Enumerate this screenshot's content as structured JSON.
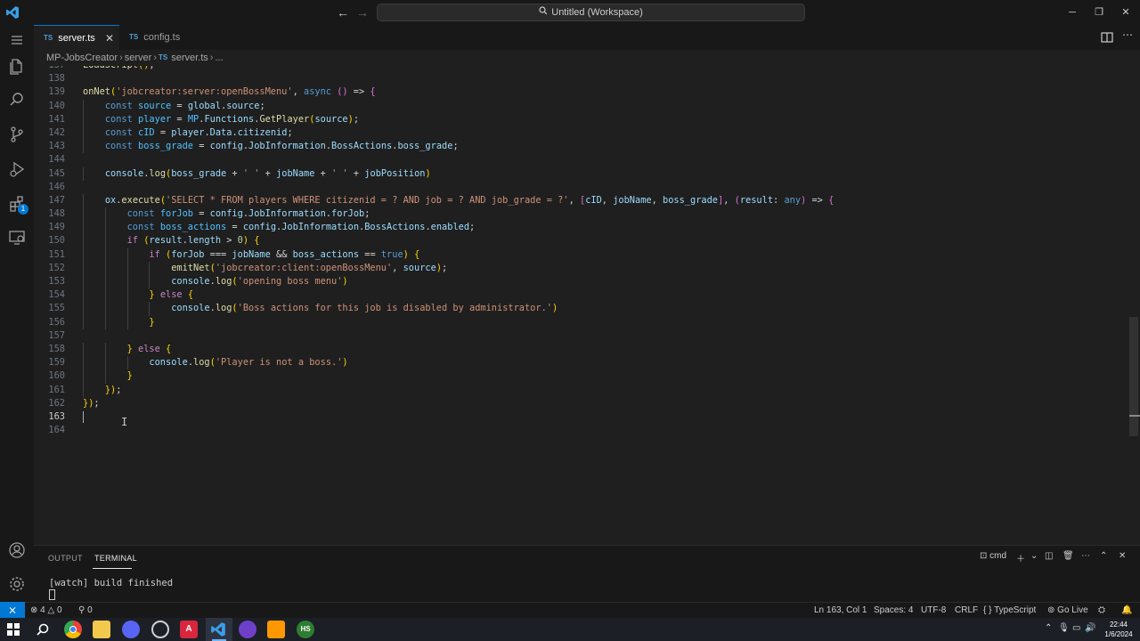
{
  "window": {
    "title": "Untitled (Workspace)"
  },
  "tabs": [
    {
      "icon": "TS",
      "label": "server.ts",
      "close": "✕"
    },
    {
      "icon": "TS",
      "label": "config.ts"
    }
  ],
  "breadcrumb": {
    "items": [
      "MP-JobsCreator",
      "server",
      "server.ts",
      "..."
    ],
    "file_icon": "TS"
  },
  "editor": {
    "cursor_line": 163,
    "lines": [
      {
        "n": "137",
        "code": "LoadScript();"
      },
      {
        "n": "138",
        "code": ""
      },
      {
        "n": "139",
        "code": "onNet('jobcreator:server:openBossMenu', async () => {"
      },
      {
        "n": "140",
        "code": "    const source = global.source;"
      },
      {
        "n": "141",
        "code": "    const player = MP.Functions.GetPlayer(source);"
      },
      {
        "n": "142",
        "code": "    const cID = player.Data.citizenid;"
      },
      {
        "n": "143",
        "code": "    const boss_grade = config.JobInformation.BossActions.boss_grade;"
      },
      {
        "n": "144",
        "code": ""
      },
      {
        "n": "145",
        "code": "    console.log(boss_grade + ' ' + jobName + ' ' + jobPosition)"
      },
      {
        "n": "146",
        "code": ""
      },
      {
        "n": "147",
        "code": "    ox.execute('SELECT * FROM players WHERE citizenid = ? AND job = ? AND job_grade = ?', [cID, jobName, boss_grade], (result: any) => {"
      },
      {
        "n": "148",
        "code": "        const forJob = config.JobInformation.forJob;"
      },
      {
        "n": "149",
        "code": "        const boss_actions = config.JobInformation.BossActions.enabled;"
      },
      {
        "n": "150",
        "code": "        if (result.length > 0) {"
      },
      {
        "n": "151",
        "code": "            if (forJob === jobName && boss_actions == true) {"
      },
      {
        "n": "152",
        "code": "                emitNet('jobcreator:client:openBossMenu', source);"
      },
      {
        "n": "153",
        "code": "                console.log('opening boss menu')"
      },
      {
        "n": "154",
        "code": "            } else {"
      },
      {
        "n": "155",
        "code": "                console.log('Boss actions for this job is disabled by administrator.')"
      },
      {
        "n": "156",
        "code": "            }"
      },
      {
        "n": "157",
        "code": ""
      },
      {
        "n": "158",
        "code": "        } else {"
      },
      {
        "n": "159",
        "code": "            console.log('Player is not a boss.')"
      },
      {
        "n": "160",
        "code": "        }"
      },
      {
        "n": "161",
        "code": "    });"
      },
      {
        "n": "162",
        "code": "});"
      },
      {
        "n": "163",
        "code": ""
      },
      {
        "n": "164",
        "code": ""
      }
    ]
  },
  "panel": {
    "tabs": [
      "OUTPUT",
      "TERMINAL"
    ],
    "active_tab": "TERMINAL",
    "shell": "cmd",
    "terminal_output": "[watch] build finished"
  },
  "statusbar": {
    "errors": "4",
    "warnings": "0",
    "ports": "0",
    "position": "Ln 163, Col 1",
    "spaces": "Spaces: 4",
    "encoding": "UTF-8",
    "eol": "CRLF",
    "language": "TypeScript",
    "golive": "Go Live",
    "language_braces": "{ }"
  },
  "activity": {
    "extensions_badge": "1"
  },
  "taskbar": {
    "apps": [
      "start-icon",
      "search-icon",
      "chrome-icon",
      "file-explorer-icon",
      "discord-icon",
      "github-icon",
      "vscode-icon",
      "app-a-icon",
      "github-desktop-icon",
      "sublime-icon",
      "hs-icon"
    ],
    "hs_label": "HS",
    "time": "22:44",
    "date": "1/6/2024"
  },
  "colors": {
    "accent": "#0078d4",
    "editor_bg": "#1f1f1f",
    "keyword": "#569cd6",
    "string": "#ce9178",
    "function": "#dcdcaa",
    "variable": "#9cdcfe"
  }
}
